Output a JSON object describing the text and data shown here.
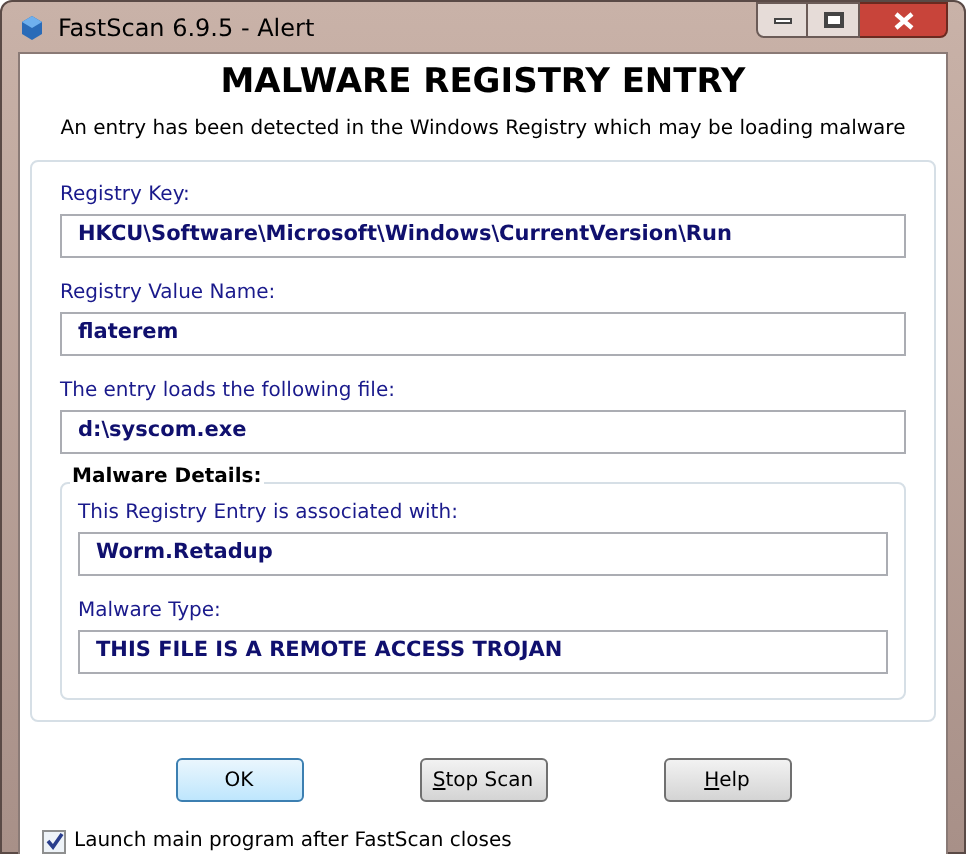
{
  "window": {
    "title": "FastScan 6.9.5 - Alert"
  },
  "heading": "MALWARE REGISTRY ENTRY",
  "subheading": "An entry has been detected in the Windows Registry which may be loading malware",
  "fields": [
    {
      "label": "Registry Key:",
      "value": "HKCU\\Software\\Microsoft\\Windows\\CurrentVersion\\Run"
    },
    {
      "label": "Registry Value Name:",
      "value": "flaterem"
    },
    {
      "label": "The entry loads the following file:",
      "value": "d:\\syscom.exe"
    }
  ],
  "details": {
    "title": "Malware Details:",
    "fields": [
      {
        "label": "This Registry Entry is associated with:",
        "value": "Worm.Retadup"
      },
      {
        "label": "Malware Type:",
        "value": "THIS FILE IS A REMOTE ACCESS TROJAN"
      }
    ]
  },
  "buttons": [
    {
      "label": "OK",
      "default": true,
      "underline_first": false
    },
    {
      "label": "Stop Scan",
      "default": false,
      "underline_first": true
    },
    {
      "label": "Help",
      "default": false,
      "underline_first": true
    }
  ],
  "launch_checkbox": {
    "label": "Launch main program after FastScan closes",
    "checked": true
  }
}
